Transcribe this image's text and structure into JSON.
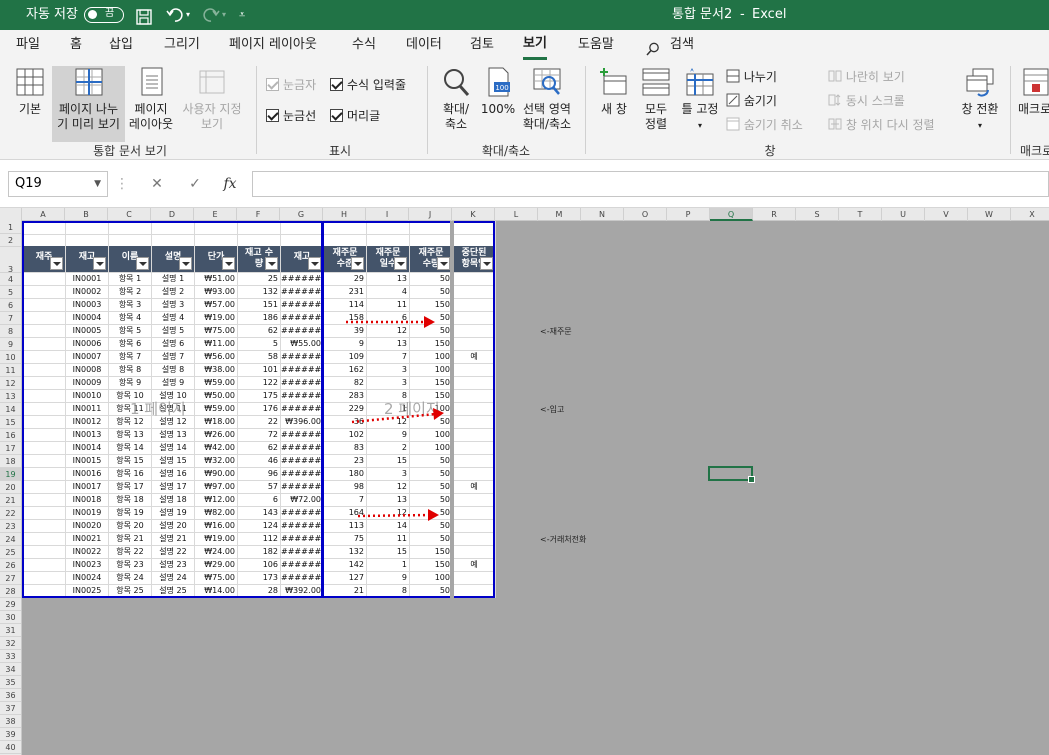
{
  "titlebar": {
    "autosave_label": "자동 저장",
    "autosave_state": "끔",
    "document_title": "통합 문서2",
    "separator": "-",
    "app_name": "Excel"
  },
  "menu": [
    "파일",
    "홈",
    "삽입",
    "그리기",
    "페이지 레이아웃",
    "수식",
    "데이터",
    "검토",
    "보기",
    "도움말",
    "검색"
  ],
  "ribbon": {
    "workbook_views": {
      "normal": "기본",
      "page_break_l1": "페이지 나누",
      "page_break_l2": "기 미리 보기",
      "page_layout_l1": "페이지",
      "page_layout_l2": "레이아웃",
      "custom_l1": "사용자 지정",
      "custom_l2": "보기",
      "group": "통합 문서 보기"
    },
    "show": {
      "ruler": "눈금자",
      "formula_bar": "수식 입력줄",
      "gridlines": "눈금선",
      "headings": "머리글",
      "group": "표시"
    },
    "zoom": {
      "zoom_l1": "확대/",
      "zoom_l2": "축소",
      "hundred": "100%",
      "to_sel_l1": "선택 영역",
      "to_sel_l2": "확대/축소",
      "group": "확대/축소"
    },
    "window": {
      "new_window": "새 창",
      "arrange_l1": "모두",
      "arrange_l2": "정렬",
      "freeze": "틀 고정",
      "split": "나누기",
      "hide": "숨기기",
      "unhide": "숨기기 취소",
      "side_by_side": "나란히 보기",
      "sync_scroll": "동시 스크롤",
      "reset_pos": "창 위치 다시 정렬",
      "switch": "창 전환",
      "group": "창"
    },
    "macros": {
      "label": "매크로",
      "group": "매크로"
    }
  },
  "formula": {
    "name_box": "Q19",
    "cancel": "✕",
    "enter": "✓",
    "fx": "fx",
    "value": ""
  },
  "columns": [
    "A",
    "B",
    "C",
    "D",
    "E",
    "F",
    "G",
    "H",
    "I",
    "J",
    "K",
    "L",
    "M",
    "N",
    "O",
    "P",
    "Q",
    "R",
    "S",
    "T",
    "U",
    "V",
    "W",
    "X"
  ],
  "selected_column": "Q",
  "selected_row": "19",
  "table": {
    "headers": [
      {
        "l1": "재주",
        "l2": ""
      },
      {
        "l1": "재고",
        "l2": ""
      },
      {
        "l1": "이름",
        "l2": ""
      },
      {
        "l1": "설명",
        "l2": ""
      },
      {
        "l1": "단가",
        "l2": ""
      },
      {
        "l1": "재고 수",
        "l2": "량"
      },
      {
        "l1": "재고",
        "l2": ""
      },
      {
        "l1": "재주문",
        "l2": "수준"
      },
      {
        "l1": "재주문",
        "l2": "일수"
      },
      {
        "l1": "재주문",
        "l2": "수량"
      },
      {
        "l1": "중단된",
        "l2": "항목인"
      }
    ],
    "rows": [
      [
        "",
        "IN0001",
        "항목 1",
        "설명 1",
        "₩51.00",
        "25",
        "########",
        "29",
        "13",
        "50",
        ""
      ],
      [
        "",
        "IN0002",
        "항목 2",
        "설명 2",
        "₩93.00",
        "132",
        "########",
        "231",
        "4",
        "50",
        ""
      ],
      [
        "",
        "IN0003",
        "항목 3",
        "설명 3",
        "₩57.00",
        "151",
        "########",
        "114",
        "11",
        "150",
        ""
      ],
      [
        "",
        "IN0004",
        "항목 4",
        "설명 4",
        "₩19.00",
        "186",
        "########",
        "158",
        "6",
        "50",
        ""
      ],
      [
        "",
        "IN0005",
        "항목 5",
        "설명 5",
        "₩75.00",
        "62",
        "########",
        "39",
        "12",
        "50",
        ""
      ],
      [
        "",
        "IN0006",
        "항목 6",
        "설명 6",
        "₩11.00",
        "5",
        "₩55.00",
        "9",
        "13",
        "150",
        ""
      ],
      [
        "",
        "IN0007",
        "항목 7",
        "설명 7",
        "₩56.00",
        "58",
        "########",
        "109",
        "7",
        "100",
        "예"
      ],
      [
        "",
        "IN0008",
        "항목 8",
        "설명 8",
        "₩38.00",
        "101",
        "########",
        "162",
        "3",
        "100",
        ""
      ],
      [
        "",
        "IN0009",
        "항목 9",
        "설명 9",
        "₩59.00",
        "122",
        "########",
        "82",
        "3",
        "150",
        ""
      ],
      [
        "",
        "IN0010",
        "항목 10",
        "설명 10",
        "₩50.00",
        "175",
        "########",
        "283",
        "8",
        "150",
        ""
      ],
      [
        "",
        "IN0011",
        "항목 11",
        "설명 11",
        "₩59.00",
        "176",
        "########",
        "229",
        "1",
        "100",
        ""
      ],
      [
        "",
        "IN0012",
        "항목 12",
        "설명 12",
        "₩18.00",
        "22",
        "₩396.00",
        "36",
        "12",
        "50",
        ""
      ],
      [
        "",
        "IN0013",
        "항목 13",
        "설명 13",
        "₩26.00",
        "72",
        "########",
        "102",
        "9",
        "100",
        ""
      ],
      [
        "",
        "IN0014",
        "항목 14",
        "설명 14",
        "₩42.00",
        "62",
        "########",
        "83",
        "2",
        "100",
        ""
      ],
      [
        "",
        "IN0015",
        "항목 15",
        "설명 15",
        "₩32.00",
        "46",
        "########",
        "23",
        "15",
        "50",
        ""
      ],
      [
        "",
        "IN0016",
        "항목 16",
        "설명 16",
        "₩90.00",
        "96",
        "########",
        "180",
        "3",
        "50",
        ""
      ],
      [
        "",
        "IN0017",
        "항목 17",
        "설명 17",
        "₩97.00",
        "57",
        "########",
        "98",
        "12",
        "50",
        "예"
      ],
      [
        "",
        "IN0018",
        "항목 18",
        "설명 18",
        "₩12.00",
        "6",
        "₩72.00",
        "7",
        "13",
        "50",
        ""
      ],
      [
        "",
        "IN0019",
        "항목 19",
        "설명 19",
        "₩82.00",
        "143",
        "########",
        "164",
        "12",
        "50",
        ""
      ],
      [
        "",
        "IN0020",
        "항목 20",
        "설명 20",
        "₩16.00",
        "124",
        "########",
        "113",
        "14",
        "50",
        ""
      ],
      [
        "",
        "IN0021",
        "항목 21",
        "설명 21",
        "₩19.00",
        "112",
        "########",
        "75",
        "11",
        "50",
        ""
      ],
      [
        "",
        "IN0022",
        "항목 22",
        "설명 22",
        "₩24.00",
        "182",
        "########",
        "132",
        "15",
        "150",
        ""
      ],
      [
        "",
        "IN0023",
        "항목 23",
        "설명 23",
        "₩29.00",
        "106",
        "########",
        "142",
        "1",
        "150",
        "예"
      ],
      [
        "",
        "IN0024",
        "항목 24",
        "설명 24",
        "₩75.00",
        "173",
        "########",
        "127",
        "9",
        "100",
        ""
      ],
      [
        "",
        "IN0025",
        "항목 25",
        "설명 25",
        "₩14.00",
        "28",
        "₩392.00",
        "21",
        "8",
        "50",
        ""
      ]
    ]
  },
  "watermarks": {
    "page1": "1 페이지",
    "page2": "2 페이지"
  },
  "notes": [
    "<-재주문",
    "<-입고",
    "<-거래처전화"
  ],
  "colors": {
    "accent": "#217346",
    "header_fill": "#44546a",
    "page_break": "#0000c8",
    "arrow": "#e00000",
    "outside": "#a6a6a6"
  }
}
